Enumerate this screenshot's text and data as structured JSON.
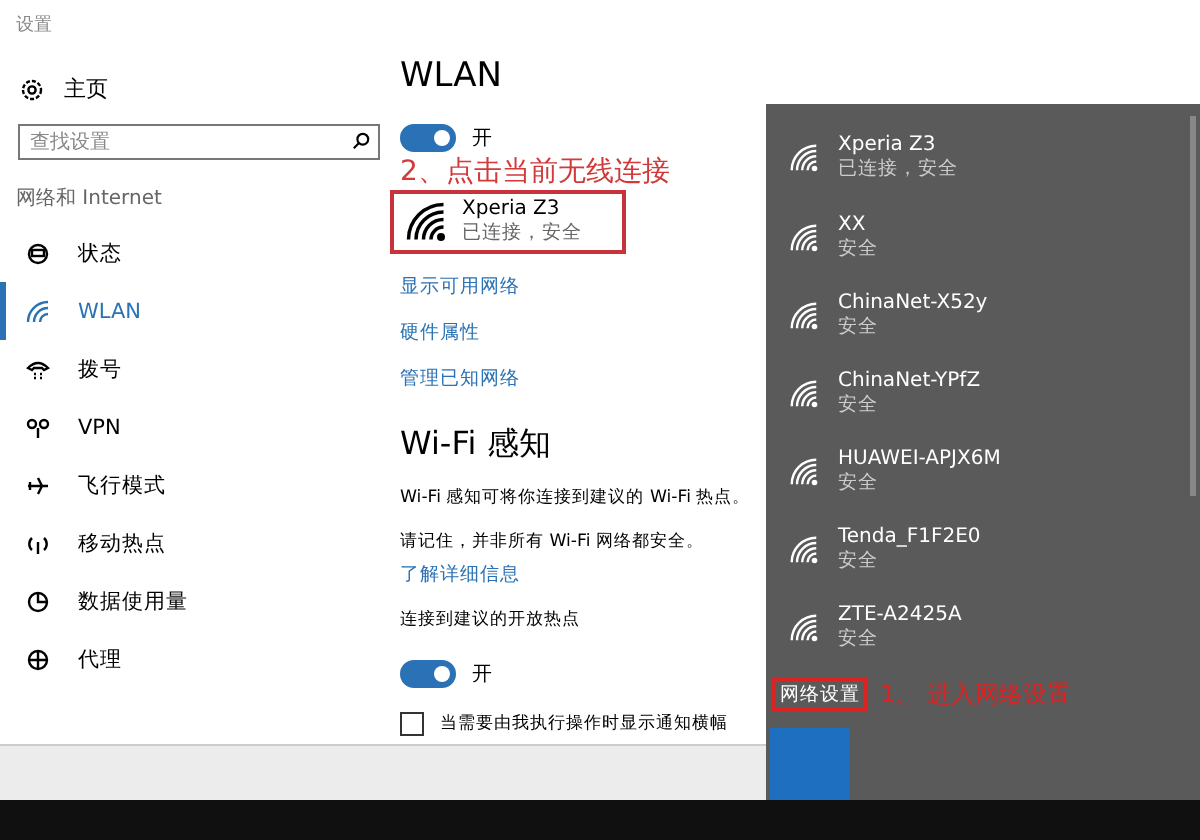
{
  "window": {
    "title": "设置"
  },
  "sidebar": {
    "home": "主页",
    "search": {
      "placeholder": "查找设置"
    },
    "section": "网络和 Internet",
    "items": [
      {
        "label": "状态",
        "selected": false
      },
      {
        "label": "WLAN",
        "selected": true
      },
      {
        "label": "拨号",
        "selected": false
      },
      {
        "label": "VPN",
        "selected": false
      },
      {
        "label": "飞行模式",
        "selected": false
      },
      {
        "label": "移动热点",
        "selected": false
      },
      {
        "label": "数据使用量",
        "selected": false
      },
      {
        "label": "代理",
        "selected": false
      }
    ]
  },
  "content": {
    "title": "WLAN",
    "wlan_toggle": {
      "on": true,
      "label": "开"
    },
    "annotation": "2、点击当前无线连接",
    "current": {
      "name": "Xperia Z3",
      "status": "已连接，安全"
    },
    "links": [
      "显示可用网络",
      "硬件属性",
      "管理已知网络"
    ],
    "sense": {
      "title": "Wi-Fi 感知",
      "text1": "Wi-Fi 感知可将你连接到建议的 Wi-Fi 热点。",
      "text2": "请记住，并非所有 Wi-Fi 网络都安全。",
      "link": "了解详细信息",
      "label": "连接到建议的开放热点",
      "toggle": {
        "on": true,
        "label": "开"
      },
      "checkbox": {
        "checked": false,
        "label": "当需要由我执行操作时显示通知横幅"
      }
    }
  },
  "flyout": {
    "networks": [
      {
        "name": "Xperia Z3",
        "status": "已连接，安全"
      },
      {
        "name": "XX",
        "status": "安全"
      },
      {
        "name": "ChinaNet-X52y",
        "status": "安全"
      },
      {
        "name": "ChinaNet-YPfZ",
        "status": "安全"
      },
      {
        "name": "HUAWEI-APJX6M",
        "status": "安全"
      },
      {
        "name": "Tenda_F1F2E0",
        "status": "安全"
      },
      {
        "name": "ZTE-A2425A",
        "status": "安全"
      }
    ],
    "settings_link": "网络设置",
    "annotation": "1、 进入网络设置"
  }
}
